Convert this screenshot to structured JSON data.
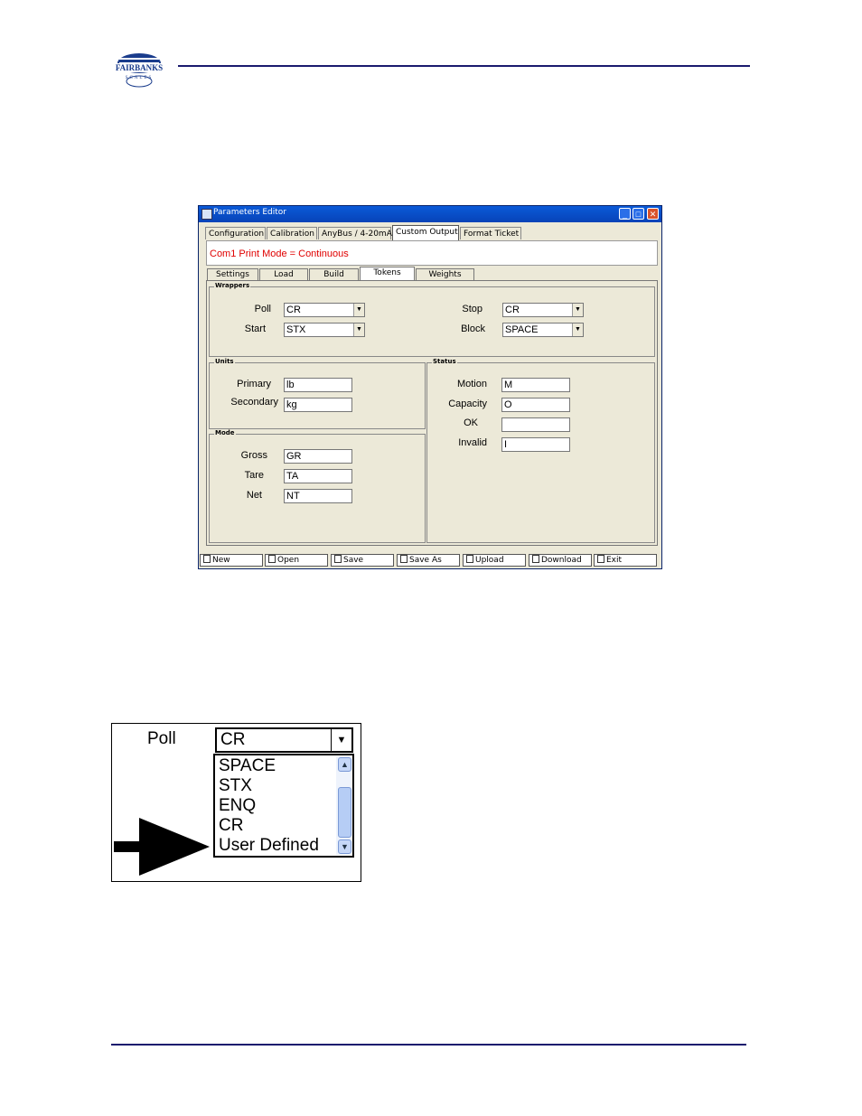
{
  "logo": {
    "brand": "FAIRBANKS",
    "sub": "SCALES"
  },
  "window": {
    "title": "Parameters Editor",
    "tabs": [
      "Configuration",
      "Calibration",
      "AnyBus / 4-20mA",
      "Custom Output",
      "Format Ticket"
    ],
    "active_tab": "Custom Output",
    "print_mode": "Com1 Print Mode = Continuous",
    "subtabs": [
      "Settings",
      "Load",
      "Build",
      "Tokens",
      "Weights"
    ],
    "active_subtab": "Tokens",
    "wrappers": {
      "legend": "Wrappers",
      "poll_label": "Poll",
      "poll_value": "CR",
      "start_label": "Start",
      "start_value": "STX",
      "stop_label": "Stop",
      "stop_value": "CR",
      "block_label": "Block",
      "block_value": "SPACE"
    },
    "units": {
      "legend": "Units",
      "primary_label": "Primary",
      "primary_value": "lb",
      "secondary_label": "Secondary",
      "secondary_value": "kg"
    },
    "mode": {
      "legend": "Mode",
      "gross_label": "Gross",
      "gross_value": "GR",
      "tare_label": "Tare",
      "tare_value": "TA",
      "net_label": "Net",
      "net_value": "NT"
    },
    "status": {
      "legend": "Status",
      "motion_label": "Motion",
      "motion_value": "M",
      "capacity_label": "Capacity",
      "capacity_value": "O",
      "ok_label": "OK",
      "ok_value": "",
      "invalid_label": "Invalid",
      "invalid_value": "I"
    },
    "buttons": [
      "New",
      "Open",
      "Save",
      "Save As",
      "Upload",
      "Download",
      "Exit"
    ]
  },
  "zoom": {
    "label": "Poll",
    "selected": "CR",
    "options": [
      "SPACE",
      "STX",
      "ENQ",
      "CR",
      "User Defined"
    ]
  },
  "colors": {
    "rule": "#1a1a6e",
    "title_bar": "#0a5ad8",
    "mode_text": "#e00000"
  }
}
